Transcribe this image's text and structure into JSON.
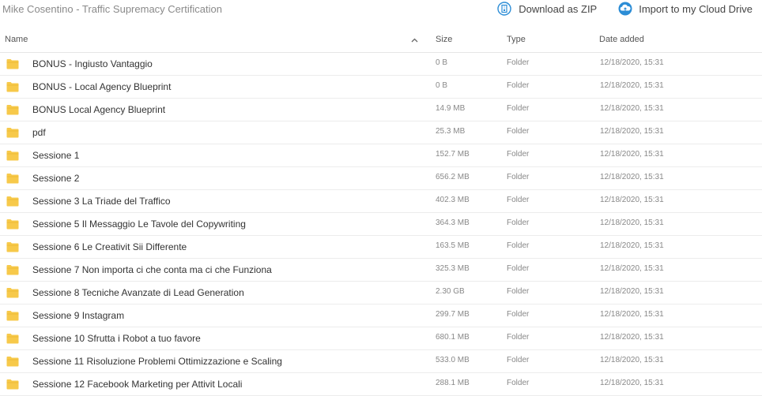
{
  "header": {
    "title": "Mike Cosentino - Traffic Supremacy Certification",
    "download_label": "Download as ZIP",
    "import_label": "Import to my Cloud Drive",
    "download_icon": "zip-archive-icon",
    "import_icon": "cloud-upload-icon",
    "accent_color": "#2c8dd6"
  },
  "columns": {
    "name": "Name",
    "size": "Size",
    "type": "Type",
    "date": "Date added",
    "sort_indicator": "^"
  },
  "folder_color": "#f7c94a",
  "rows": [
    {
      "name": "BONUS - Ingiusto Vantaggio",
      "size": "0 B",
      "type": "Folder",
      "date": "12/18/2020, 15:31"
    },
    {
      "name": "BONUS - Local Agency Blueprint",
      "size": "0 B",
      "type": "Folder",
      "date": "12/18/2020, 15:31"
    },
    {
      "name": "BONUS Local Agency Blueprint",
      "size": "14.9 MB",
      "type": "Folder",
      "date": "12/18/2020, 15:31"
    },
    {
      "name": "pdf",
      "size": "25.3 MB",
      "type": "Folder",
      "date": "12/18/2020, 15:31"
    },
    {
      "name": "Sessione 1",
      "size": "152.7 MB",
      "type": "Folder",
      "date": "12/18/2020, 15:31"
    },
    {
      "name": "Sessione 2",
      "size": "656.2 MB",
      "type": "Folder",
      "date": "12/18/2020, 15:31"
    },
    {
      "name": "Sessione 3 La Triade del Traffico",
      "size": "402.3 MB",
      "type": "Folder",
      "date": "12/18/2020, 15:31"
    },
    {
      "name": "Sessione 5 Il Messaggio Le Tavole del Copywriting",
      "size": "364.3 MB",
      "type": "Folder",
      "date": "12/18/2020, 15:31"
    },
    {
      "name": "Sessione 6 Le Creativit Sii Differente",
      "size": "163.5 MB",
      "type": "Folder",
      "date": "12/18/2020, 15:31"
    },
    {
      "name": "Sessione 7 Non importa ci che conta ma ci che Funziona",
      "size": "325.3 MB",
      "type": "Folder",
      "date": "12/18/2020, 15:31"
    },
    {
      "name": "Sessione 8 Tecniche Avanzate di Lead Generation",
      "size": "2.30 GB",
      "type": "Folder",
      "date": "12/18/2020, 15:31"
    },
    {
      "name": "Sessione 9 Instagram",
      "size": "299.7 MB",
      "type": "Folder",
      "date": "12/18/2020, 15:31"
    },
    {
      "name": "Sessione 10 Sfrutta i Robot a tuo favore",
      "size": "680.1 MB",
      "type": "Folder",
      "date": "12/18/2020, 15:31"
    },
    {
      "name": "Sessione 11 Risoluzione Problemi Ottimizzazione e Scaling",
      "size": "533.0 MB",
      "type": "Folder",
      "date": "12/18/2020, 15:31"
    },
    {
      "name": "Sessione 12 Facebook Marketing per Attivit Locali",
      "size": "288.1 MB",
      "type": "Folder",
      "date": "12/18/2020, 15:31"
    }
  ]
}
